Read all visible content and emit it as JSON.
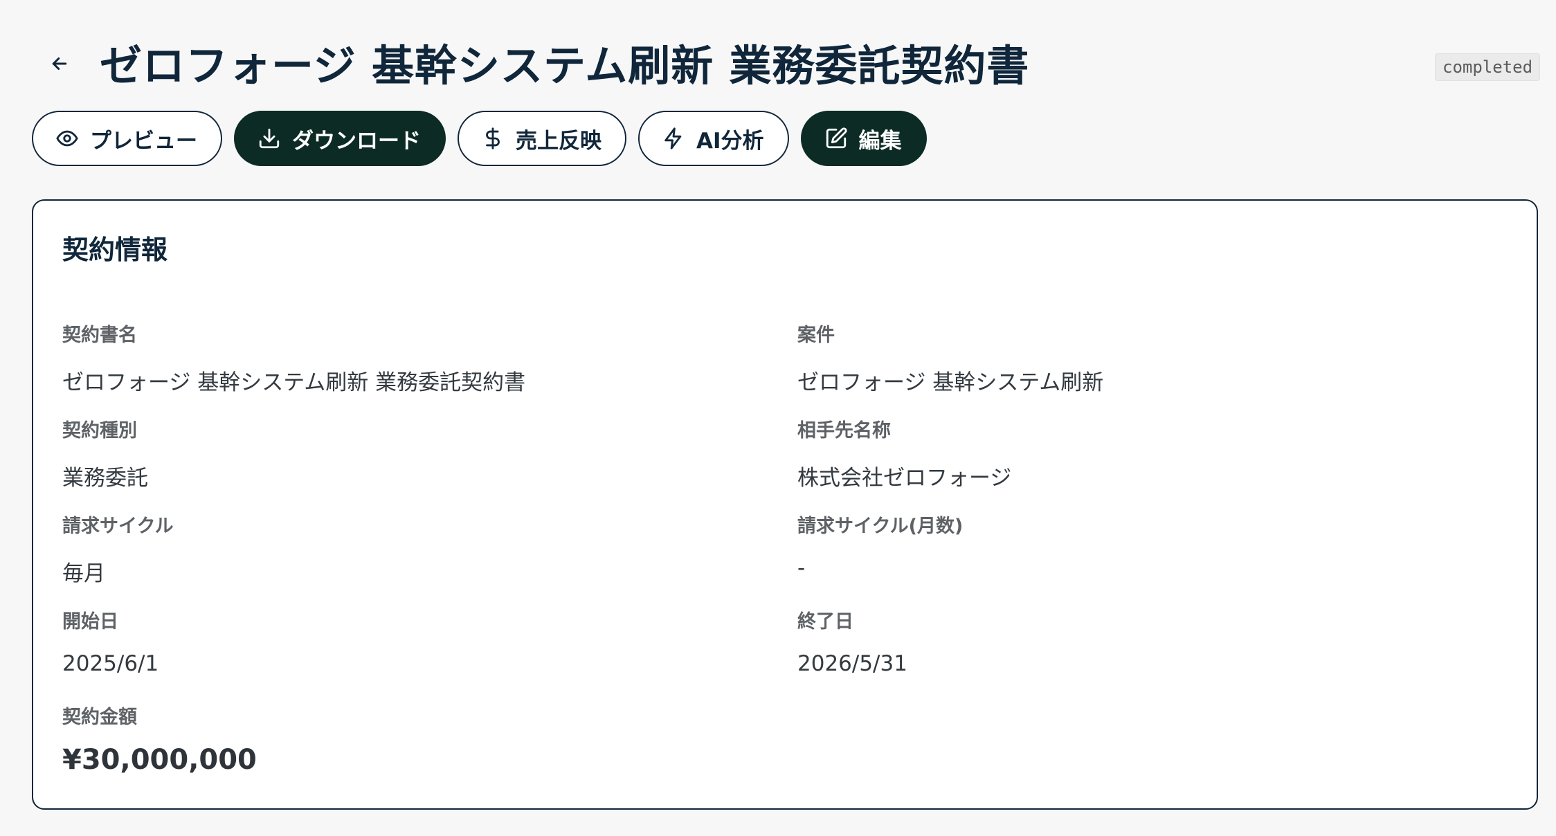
{
  "header": {
    "back_icon": "arrow-left-icon",
    "title": "ゼロフォージ 基幹システム刷新 業務委託契約書",
    "status": "completed"
  },
  "actions": [
    {
      "label": "プレビュー",
      "icon": "eye-icon"
    },
    {
      "label": "ダウンロード",
      "icon": "download-icon"
    },
    {
      "label": "売上反映",
      "icon": "dollar-icon"
    },
    {
      "label": "AI分析",
      "icon": "lightning-icon"
    },
    {
      "label": "編集",
      "icon": "edit-icon"
    }
  ],
  "colors": {
    "primary_dark": "#0c2b25",
    "title_text": "#10263a",
    "background": "#f7f7f7"
  },
  "contract": {
    "section_title": "契約情報",
    "fields": {
      "name": {
        "label": "契約書名",
        "value": "ゼロフォージ 基幹システム刷新 業務委託契約書"
      },
      "project": {
        "label": "案件",
        "value": "ゼロフォージ 基幹システム刷新"
      },
      "type": {
        "label": "契約種別",
        "value": "業務委託"
      },
      "counterparty": {
        "label": "相手先名称",
        "value": "株式会社ゼロフォージ"
      },
      "billing_cycle": {
        "label": "請求サイクル",
        "value": "毎月"
      },
      "billing_cycle_months": {
        "label": "請求サイクル(月数)",
        "value": "-"
      },
      "start_date": {
        "label": "開始日",
        "value": "2025/6/1"
      },
      "end_date": {
        "label": "終了日",
        "value": "2026/5/31"
      },
      "amount": {
        "label": "契約金額",
        "value": "¥30,000,000"
      }
    }
  }
}
